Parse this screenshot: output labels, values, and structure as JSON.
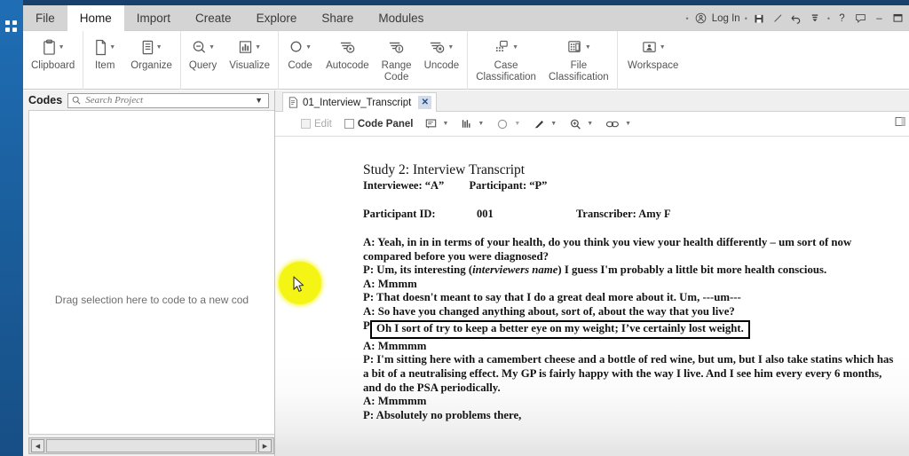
{
  "window": {
    "accent_blue": "#1f6eb5",
    "titlebar_color": "#17406b",
    "rail_icon": "four-squares-icon"
  },
  "ribbon": {
    "tabs": [
      {
        "label": "File",
        "active": false
      },
      {
        "label": "Home",
        "active": true
      },
      {
        "label": "Import",
        "active": false
      },
      {
        "label": "Create",
        "active": false
      },
      {
        "label": "Explore",
        "active": false
      },
      {
        "label": "Share",
        "active": false
      },
      {
        "label": "Modules",
        "active": false
      }
    ],
    "window_controls": {
      "login_label": "Log In",
      "help_label": "?",
      "minimize_label": "–",
      "maximize_label": "☐",
      "icons": [
        "user-circle-icon",
        "save-icon",
        "pencil-icon",
        "undo-icon",
        "redo-dropdown-icon",
        "help-icon",
        "comment-icon",
        "minimize-icon",
        "maximize-icon"
      ]
    },
    "groups": [
      {
        "name": "clipboard-group",
        "buttons": [
          {
            "label": "Clipboard",
            "icon": "clipboard-icon",
            "has_caret": true
          }
        ]
      },
      {
        "name": "items-group",
        "buttons": [
          {
            "label": "Item",
            "icon": "document-icon",
            "has_caret": true
          },
          {
            "label": "Organize",
            "icon": "list-board-icon",
            "has_caret": true
          }
        ]
      },
      {
        "name": "explore-group",
        "buttons": [
          {
            "label": "Query",
            "icon": "magnifier-icon",
            "has_caret": true
          },
          {
            "label": "Visualize",
            "icon": "bar-chart-icon",
            "has_caret": true
          }
        ]
      },
      {
        "name": "coding-group",
        "buttons": [
          {
            "label": "Code",
            "icon": "circle-code-icon",
            "has_caret": true
          },
          {
            "label": "Autocode",
            "icon": "autocode-icon",
            "has_caret": false
          },
          {
            "label": "Range\nCode",
            "icon": "range-code-icon",
            "has_caret": false
          },
          {
            "label": "Uncode",
            "icon": "uncode-icon",
            "has_caret": true
          }
        ]
      },
      {
        "name": "classification-group",
        "buttons": [
          {
            "label": "Case\nClassification",
            "icon": "case-classification-icon",
            "has_caret": true
          },
          {
            "label": "File\nClassification",
            "icon": "file-classification-icon",
            "has_caret": true
          }
        ]
      },
      {
        "name": "workspace-group",
        "buttons": [
          {
            "label": "Workspace",
            "icon": "workspace-icon",
            "has_caret": true
          }
        ]
      }
    ]
  },
  "codes_panel": {
    "title": "Codes",
    "search": {
      "placeholder": "Search Project",
      "value": "",
      "icon": "search-icon",
      "dropdown_icon": "chevron-down-icon"
    },
    "drop_hint": "Drag selection here to code to a new cod",
    "scrollbar": {
      "left_arrow": "◀",
      "right_arrow": "▶"
    }
  },
  "document_pane": {
    "tab": {
      "label": "01_Interview_Transcript",
      "file_icon": "document-icon",
      "close_label": "✕"
    },
    "toolbar": {
      "edit_label": "Edit",
      "code_panel_label": "Code Panel",
      "icons": [
        "annotation-icon",
        "stripes-icon",
        "circle-code-icon",
        "highlighter-icon",
        "zoom-icon",
        "link-icon"
      ],
      "right_icon": "open-pane-icon"
    },
    "content": {
      "title": "Study 2: Interview Transcript",
      "subtitle_interviewee": "Interviewee: “A”",
      "subtitle_participant": "Participant: “P”",
      "meta_label_id": "Participant ID:",
      "meta_value_id": "001",
      "meta_label_transcriber": "Transcriber: Amy F",
      "lines": [
        {
          "text": "A: Yeah, in in in terms of your health, do you think you view your health differently – um sort of now compared before you were diagnosed?",
          "coded": false
        },
        {
          "text": "P: Um, its interesting (interviewers name) I guess I'm probably a little bit more health conscious.",
          "coded": false,
          "italic_part": "interviewers name"
        },
        {
          "text": "A: Mmmm",
          "coded": false
        },
        {
          "text": "P: That doesn't meant to say that I do a great deal more about it. Um, ---um---",
          "coded": false
        },
        {
          "text": "A: So have you changed anything about, sort of, about the way that you live?",
          "coded": false
        },
        {
          "text": "P:",
          "coded": false
        },
        {
          "text": "Oh I sort of try to keep a better eye on my weight; I’ve certainly lost weight.",
          "coded": true
        },
        {
          "text": "A: Mmmmm",
          "coded": false
        },
        {
          "text": "P: I'm sitting here with a camembert cheese and a bottle of red wine, but um, but I also take statins which has a bit of a neutralising effect. My GP is fairly happy with the way I live. And I see him every every 6 months, and do the PSA periodically.",
          "coded": false
        },
        {
          "text": "A: Mmmmm",
          "coded": false
        },
        {
          "text": "P: Absolutely no problems there,",
          "coded": false
        }
      ]
    }
  },
  "cursor": {
    "highlight_color": "#f5f515",
    "pointer_icon": "mouse-pointer-icon"
  }
}
